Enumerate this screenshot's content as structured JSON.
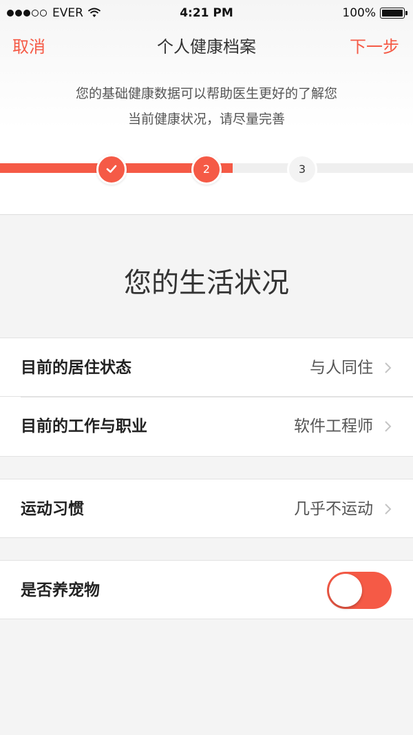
{
  "status_bar": {
    "carrier": "EVER",
    "time": "4:21 PM",
    "battery": "100%"
  },
  "nav": {
    "cancel": "取消",
    "title": "个人健康档案",
    "next": "下一步"
  },
  "intro": {
    "line1": "您的基础健康数据可以帮助医生更好的了解您",
    "line2": "当前健康状况，请尽量完善"
  },
  "progress": {
    "steps": [
      "✓",
      "2",
      "3"
    ],
    "current_step": 2,
    "total_steps": 3,
    "accent_color": "#f55a46"
  },
  "section": {
    "title": "您的生活状况"
  },
  "rows": {
    "living": {
      "label": "目前的居住状态",
      "value": "与人同住"
    },
    "job": {
      "label": "目前的工作与职业",
      "value": "软件工程师"
    },
    "exercise": {
      "label": "运动习惯",
      "value": "几乎不运动"
    },
    "pets": {
      "label": "是否养宠物",
      "toggle_on": false
    }
  },
  "icons": {
    "wifi": "wifi-icon",
    "battery": "battery-icon",
    "check": "check-icon",
    "chevron": "chevron-right-icon"
  }
}
